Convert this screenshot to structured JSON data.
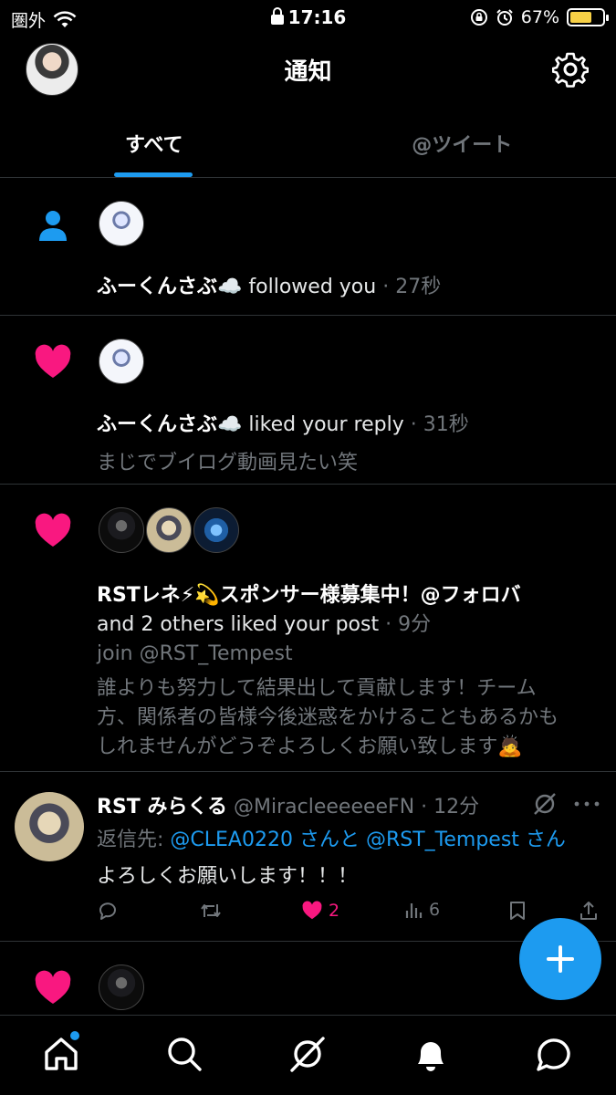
{
  "status_bar": {
    "carrier": "圏外",
    "time": "17:16",
    "battery": "67%",
    "battery_level": 0.67
  },
  "header": {
    "title": "通知"
  },
  "tabs": [
    {
      "label": "すべて",
      "active": true
    },
    {
      "label": "@ツイート",
      "active": false
    }
  ],
  "notifications": [
    {
      "type": "follow",
      "user": "ふーくんさぶ☁️",
      "action": "followed you",
      "sep": " · ",
      "time": "27秒"
    },
    {
      "type": "like",
      "user": "ふーくんさぶ☁️",
      "action": "liked your reply",
      "sep": " · ",
      "time": "31秒",
      "preview": "まじでブイログ動画見たい笑"
    },
    {
      "type": "like",
      "user": "RSTレネ⚡💫スポンサー様募集中！@フォロバ",
      "action": "and 2 others liked your post",
      "sep": " · ",
      "time": "9分",
      "preview_lines": [
        "join @RST_Tempest",
        "誰よりも努力して結果出して貢献します！チーム",
        "方、関係者の皆様今後迷惑をかけることもあるかも",
        "しれませんがどうぞよろしくお願い致します🙇"
      ]
    }
  ],
  "reply": {
    "name": "RST みらくる",
    "handle": "@MiracleeeeeeFN",
    "sep": " · ",
    "time": "12分",
    "reply_to_prefix": "返信先: ",
    "reply_to_1": "@CLEA0220",
    "reply_to_mid": " さんと ",
    "reply_to_2": "@RST_Tempest",
    "reply_to_suffix": " さん",
    "text": "よろしくお願いします！！！",
    "likes": "2",
    "views": "6",
    "colors": {
      "like": "#f91880",
      "link": "#1d9bf0"
    }
  },
  "icons": [
    "person-icon",
    "heart-icon",
    "gear-icon",
    "home-icon",
    "search-icon",
    "spaces-icon",
    "bell-icon",
    "chat-icon"
  ]
}
